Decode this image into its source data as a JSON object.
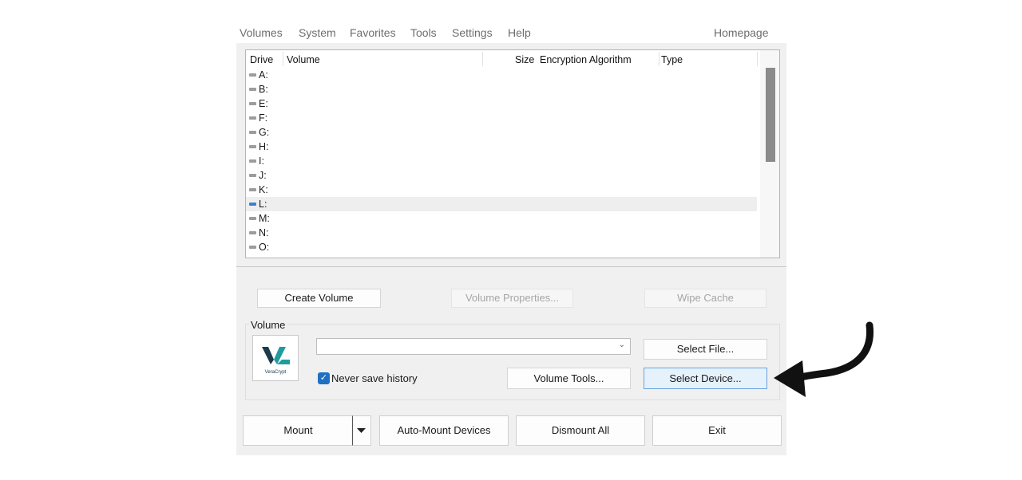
{
  "menu": {
    "items": [
      "Volumes",
      "System",
      "Favorites",
      "Tools",
      "Settings",
      "Help"
    ],
    "homepage": "Homepage"
  },
  "drive_list": {
    "columns": [
      "Drive",
      "Volume",
      "Size",
      "Encryption Algorithm",
      "Type"
    ],
    "drives": [
      "A:",
      "B:",
      "E:",
      "F:",
      "G:",
      "H:",
      "I:",
      "J:",
      "K:",
      "L:",
      "M:",
      "N:",
      "O:"
    ],
    "selected": "L:"
  },
  "buttons": {
    "create_volume": "Create Volume",
    "volume_properties": "Volume Properties...",
    "wipe_cache": "Wipe Cache",
    "select_file": "Select File...",
    "volume_tools": "Volume Tools...",
    "select_device": "Select Device..."
  },
  "volume": {
    "label": "Volume",
    "path_value": "",
    "never_save_history_label": "Never save history",
    "never_save_history_checked": true,
    "logo_text": "VeraCrypt"
  },
  "bottom": {
    "mount": "Mount",
    "auto_mount": "Auto-Mount Devices",
    "dismount_all": "Dismount All",
    "exit": "Exit"
  },
  "colors": {
    "accent": "#1f70c1",
    "logo_teal": "#1e9c9e",
    "logo_dark": "#1c3a4c"
  }
}
